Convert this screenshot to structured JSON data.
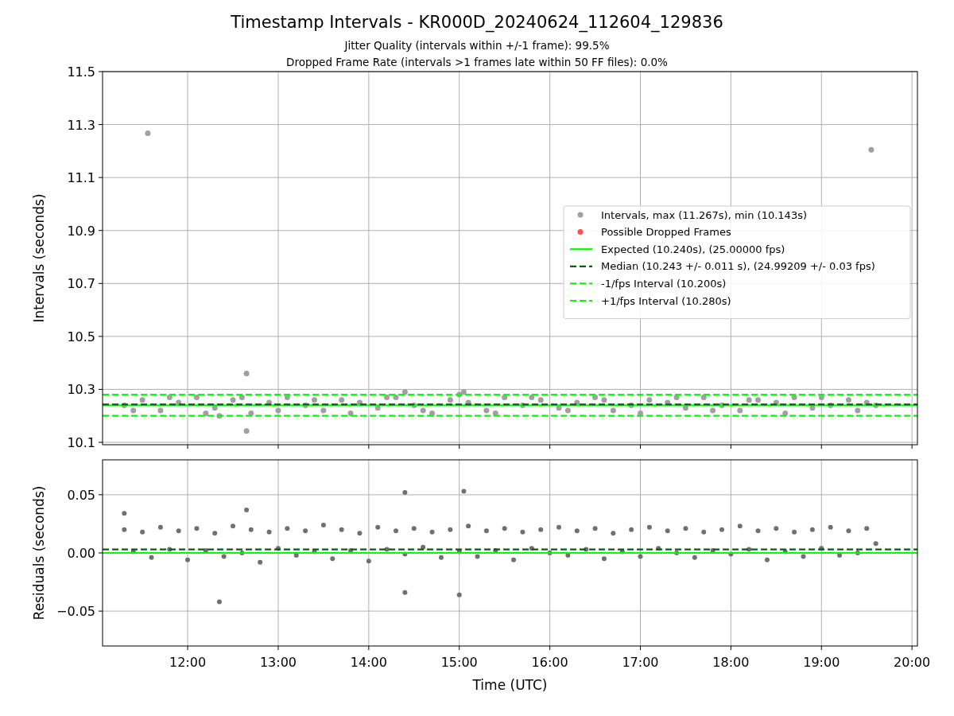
{
  "figure": {
    "title": "Timestamp Intervals - KR000D_20240624_112604_129836",
    "subtitles": [
      "Jitter Quality (intervals within +/-1 frame): 99.5%",
      "Dropped Frame Rate (intervals >1 frames late within 50 FF files): 0.0%"
    ]
  },
  "charts": [
    {
      "chart_data": {
        "type": "scatter",
        "ylabel": "Intervals (seconds)",
        "grid": true,
        "legend": true,
        "xlim": [
          11.06,
          20.06
        ],
        "ylim": [
          10.091,
          11.5
        ],
        "yticks": [
          {
            "value": 10.1,
            "label": "10.1"
          },
          {
            "value": 10.3,
            "label": "10.3"
          },
          {
            "value": 10.5,
            "label": "10.5"
          },
          {
            "value": 10.7,
            "label": "10.7"
          },
          {
            "value": 10.9,
            "label": "10.9"
          },
          {
            "value": 11.1,
            "label": "11.1"
          },
          {
            "value": 11.3,
            "label": "11.3"
          },
          {
            "value": 11.5,
            "label": "11.5"
          }
        ],
        "series": [
          {
            "name": "Intervals, max (11.267s), min (10.143s)",
            "color": "#a0a0a0",
            "x": [
              11.3,
              11.5,
              11.7,
              11.9,
              12.1,
              12.3,
              12.5,
              12.7,
              12.9,
              13.1,
              13.3,
              13.5,
              13.7,
              13.9,
              14.1,
              14.3,
              14.5,
              14.7,
              14.9,
              15.1,
              15.3,
              15.5,
              15.7,
              15.9,
              16.1,
              16.3,
              16.5,
              16.7,
              16.9,
              17.1,
              17.3,
              17.5,
              17.7,
              17.9,
              18.1,
              18.3,
              18.5,
              18.7,
              18.9,
              19.1,
              19.3,
              19.5,
              11.56,
              19.55,
              12.65,
              12.65,
              12.35,
              14.4,
              15.05,
              11.4,
              11.8,
              12.2,
              12.6,
              13.0,
              13.4,
              13.8,
              14.2,
              14.6,
              15.0,
              15.4,
              15.8,
              16.2,
              16.6,
              17.0,
              17.4,
              17.8,
              18.2,
              18.6,
              19.0,
              19.4,
              19.6
            ],
            "values": [
              10.24,
              10.26,
              10.22,
              10.25,
              10.27,
              10.23,
              10.26,
              10.21,
              10.25,
              10.27,
              10.24,
              10.22,
              10.26,
              10.25,
              10.23,
              10.27,
              10.24,
              10.21,
              10.26,
              10.25,
              10.22,
              10.27,
              10.24,
              10.26,
              10.23,
              10.25,
              10.27,
              10.22,
              10.24,
              10.26,
              10.25,
              10.23,
              10.27,
              10.24,
              10.22,
              10.26,
              10.25,
              10.27,
              10.23,
              10.24,
              10.26,
              10.25,
              11.267,
              11.205,
              10.36,
              10.143,
              10.2,
              10.29,
              10.29,
              10.22,
              10.27,
              10.21,
              10.27,
              10.22,
              10.26,
              10.21,
              10.27,
              10.22,
              10.28,
              10.21,
              10.27,
              10.22,
              10.26,
              10.21,
              10.27,
              10.22,
              10.26,
              10.21,
              10.27,
              10.22,
              10.24
            ]
          },
          {
            "name": "Possible Dropped Frames",
            "color": "#ff5050"
          },
          {
            "name": "Expected (10.240s), (25.00000 fps)",
            "color": "#00ff00",
            "type": "line",
            "line_style": "solid",
            "x": [
              11.06,
              20.06
            ],
            "values": [
              10.24,
              10.24
            ]
          },
          {
            "name": "Median (10.243 +/- 0.011 s), (24.99209 +/- 0.03 fps)",
            "color": "#006400",
            "type": "line",
            "line_style": "dashed",
            "x": [
              11.06,
              20.06
            ],
            "values": [
              10.243,
              10.243
            ]
          },
          {
            "name": "-1/fps Interval (10.200s)",
            "color": "#00ff00",
            "type": "line",
            "line_style": "dashed",
            "x": [
              11.06,
              20.06
            ],
            "values": [
              10.2,
              10.2
            ]
          },
          {
            "name": "+1/fps Interval (10.280s)",
            "color": "#00ff00",
            "type": "line",
            "line_style": "dashed",
            "x": [
              11.06,
              20.06
            ],
            "values": [
              10.28,
              10.28
            ]
          }
        ]
      }
    },
    {
      "chart_data": {
        "type": "scatter",
        "xlabel": "Time (UTC)",
        "ylabel": "Residuals (seconds)",
        "grid": true,
        "xlim": [
          11.06,
          20.06
        ],
        "ylim": [
          -0.08,
          0.08
        ],
        "xticks": [
          {
            "value": 12,
            "label": "12:00"
          },
          {
            "value": 13,
            "label": "13:00"
          },
          {
            "value": 14,
            "label": "14:00"
          },
          {
            "value": 15,
            "label": "15:00"
          },
          {
            "value": 16,
            "label": "16:00"
          },
          {
            "value": 17,
            "label": "17:00"
          },
          {
            "value": 18,
            "label": "18:00"
          },
          {
            "value": 19,
            "label": "19:00"
          },
          {
            "value": 20,
            "label": "20:00"
          }
        ],
        "yticks": [
          {
            "value": -0.05,
            "label": "−0.05"
          },
          {
            "value": 0,
            "label": "0.00"
          },
          {
            "value": 0.05,
            "label": "0.05"
          }
        ],
        "series": [
          {
            "color": "#707070",
            "x": [
              11.3,
              11.4,
              11.5,
              11.6,
              11.7,
              11.8,
              11.9,
              12.0,
              12.1,
              12.2,
              12.3,
              12.4,
              12.5,
              12.6,
              12.7,
              12.8,
              12.9,
              13.0,
              13.1,
              13.2,
              13.3,
              13.4,
              13.5,
              13.6,
              13.7,
              13.8,
              13.9,
              14.0,
              14.1,
              14.2,
              14.3,
              14.4,
              14.5,
              14.6,
              14.7,
              14.8,
              14.9,
              15.0,
              15.1,
              15.2,
              15.3,
              15.4,
              15.5,
              15.6,
              15.7,
              15.8,
              15.9,
              16.0,
              16.1,
              16.2,
              16.3,
              16.4,
              16.5,
              16.6,
              16.7,
              16.8,
              16.9,
              17.0,
              17.1,
              17.2,
              17.3,
              17.4,
              17.5,
              17.6,
              17.7,
              17.8,
              17.9,
              18.0,
              18.1,
              18.2,
              18.3,
              18.4,
              18.5,
              18.6,
              18.7,
              18.8,
              18.9,
              19.0,
              19.1,
              19.2,
              19.3,
              19.4,
              19.5,
              19.6,
              12.35,
              14.4,
              15.05,
              15.0,
              14.4,
              11.3,
              12.65
            ],
            "values": [
              0.02,
              0.001,
              0.018,
              -0.004,
              0.022,
              0.003,
              0.019,
              -0.006,
              0.021,
              0.002,
              0.017,
              -0.003,
              0.023,
              0.0,
              0.02,
              -0.008,
              0.018,
              0.004,
              0.021,
              -0.002,
              0.019,
              0.001,
              0.024,
              -0.005,
              0.02,
              0.002,
              0.017,
              -0.007,
              0.022,
              0.003,
              0.019,
              -0.001,
              0.021,
              0.005,
              0.018,
              -0.004,
              0.02,
              0.001,
              0.023,
              -0.003,
              0.019,
              0.002,
              0.021,
              -0.006,
              0.018,
              0.004,
              0.02,
              0.0,
              0.022,
              -0.002,
              0.019,
              0.003,
              0.021,
              -0.005,
              0.017,
              0.001,
              0.02,
              -0.003,
              0.022,
              0.004,
              0.019,
              0.0,
              0.021,
              -0.004,
              0.018,
              0.002,
              0.02,
              -0.001,
              0.023,
              0.003,
              0.019,
              -0.006,
              0.021,
              0.001,
              0.018,
              -0.003,
              0.02,
              0.004,
              0.022,
              -0.002,
              0.019,
              0.0,
              0.021,
              0.008,
              -0.042,
              0.052,
              0.053,
              -0.036,
              -0.034,
              0.034,
              0.037
            ]
          },
          {
            "color": "#00ff00",
            "type": "line",
            "line_style": "solid",
            "x": [
              11.06,
              20.06
            ],
            "values": [
              0,
              0
            ]
          },
          {
            "color": "#006400",
            "type": "line",
            "line_style": "dashed",
            "x": [
              11.06,
              20.06
            ],
            "values": [
              0.003,
              0.003
            ]
          }
        ]
      }
    }
  ]
}
